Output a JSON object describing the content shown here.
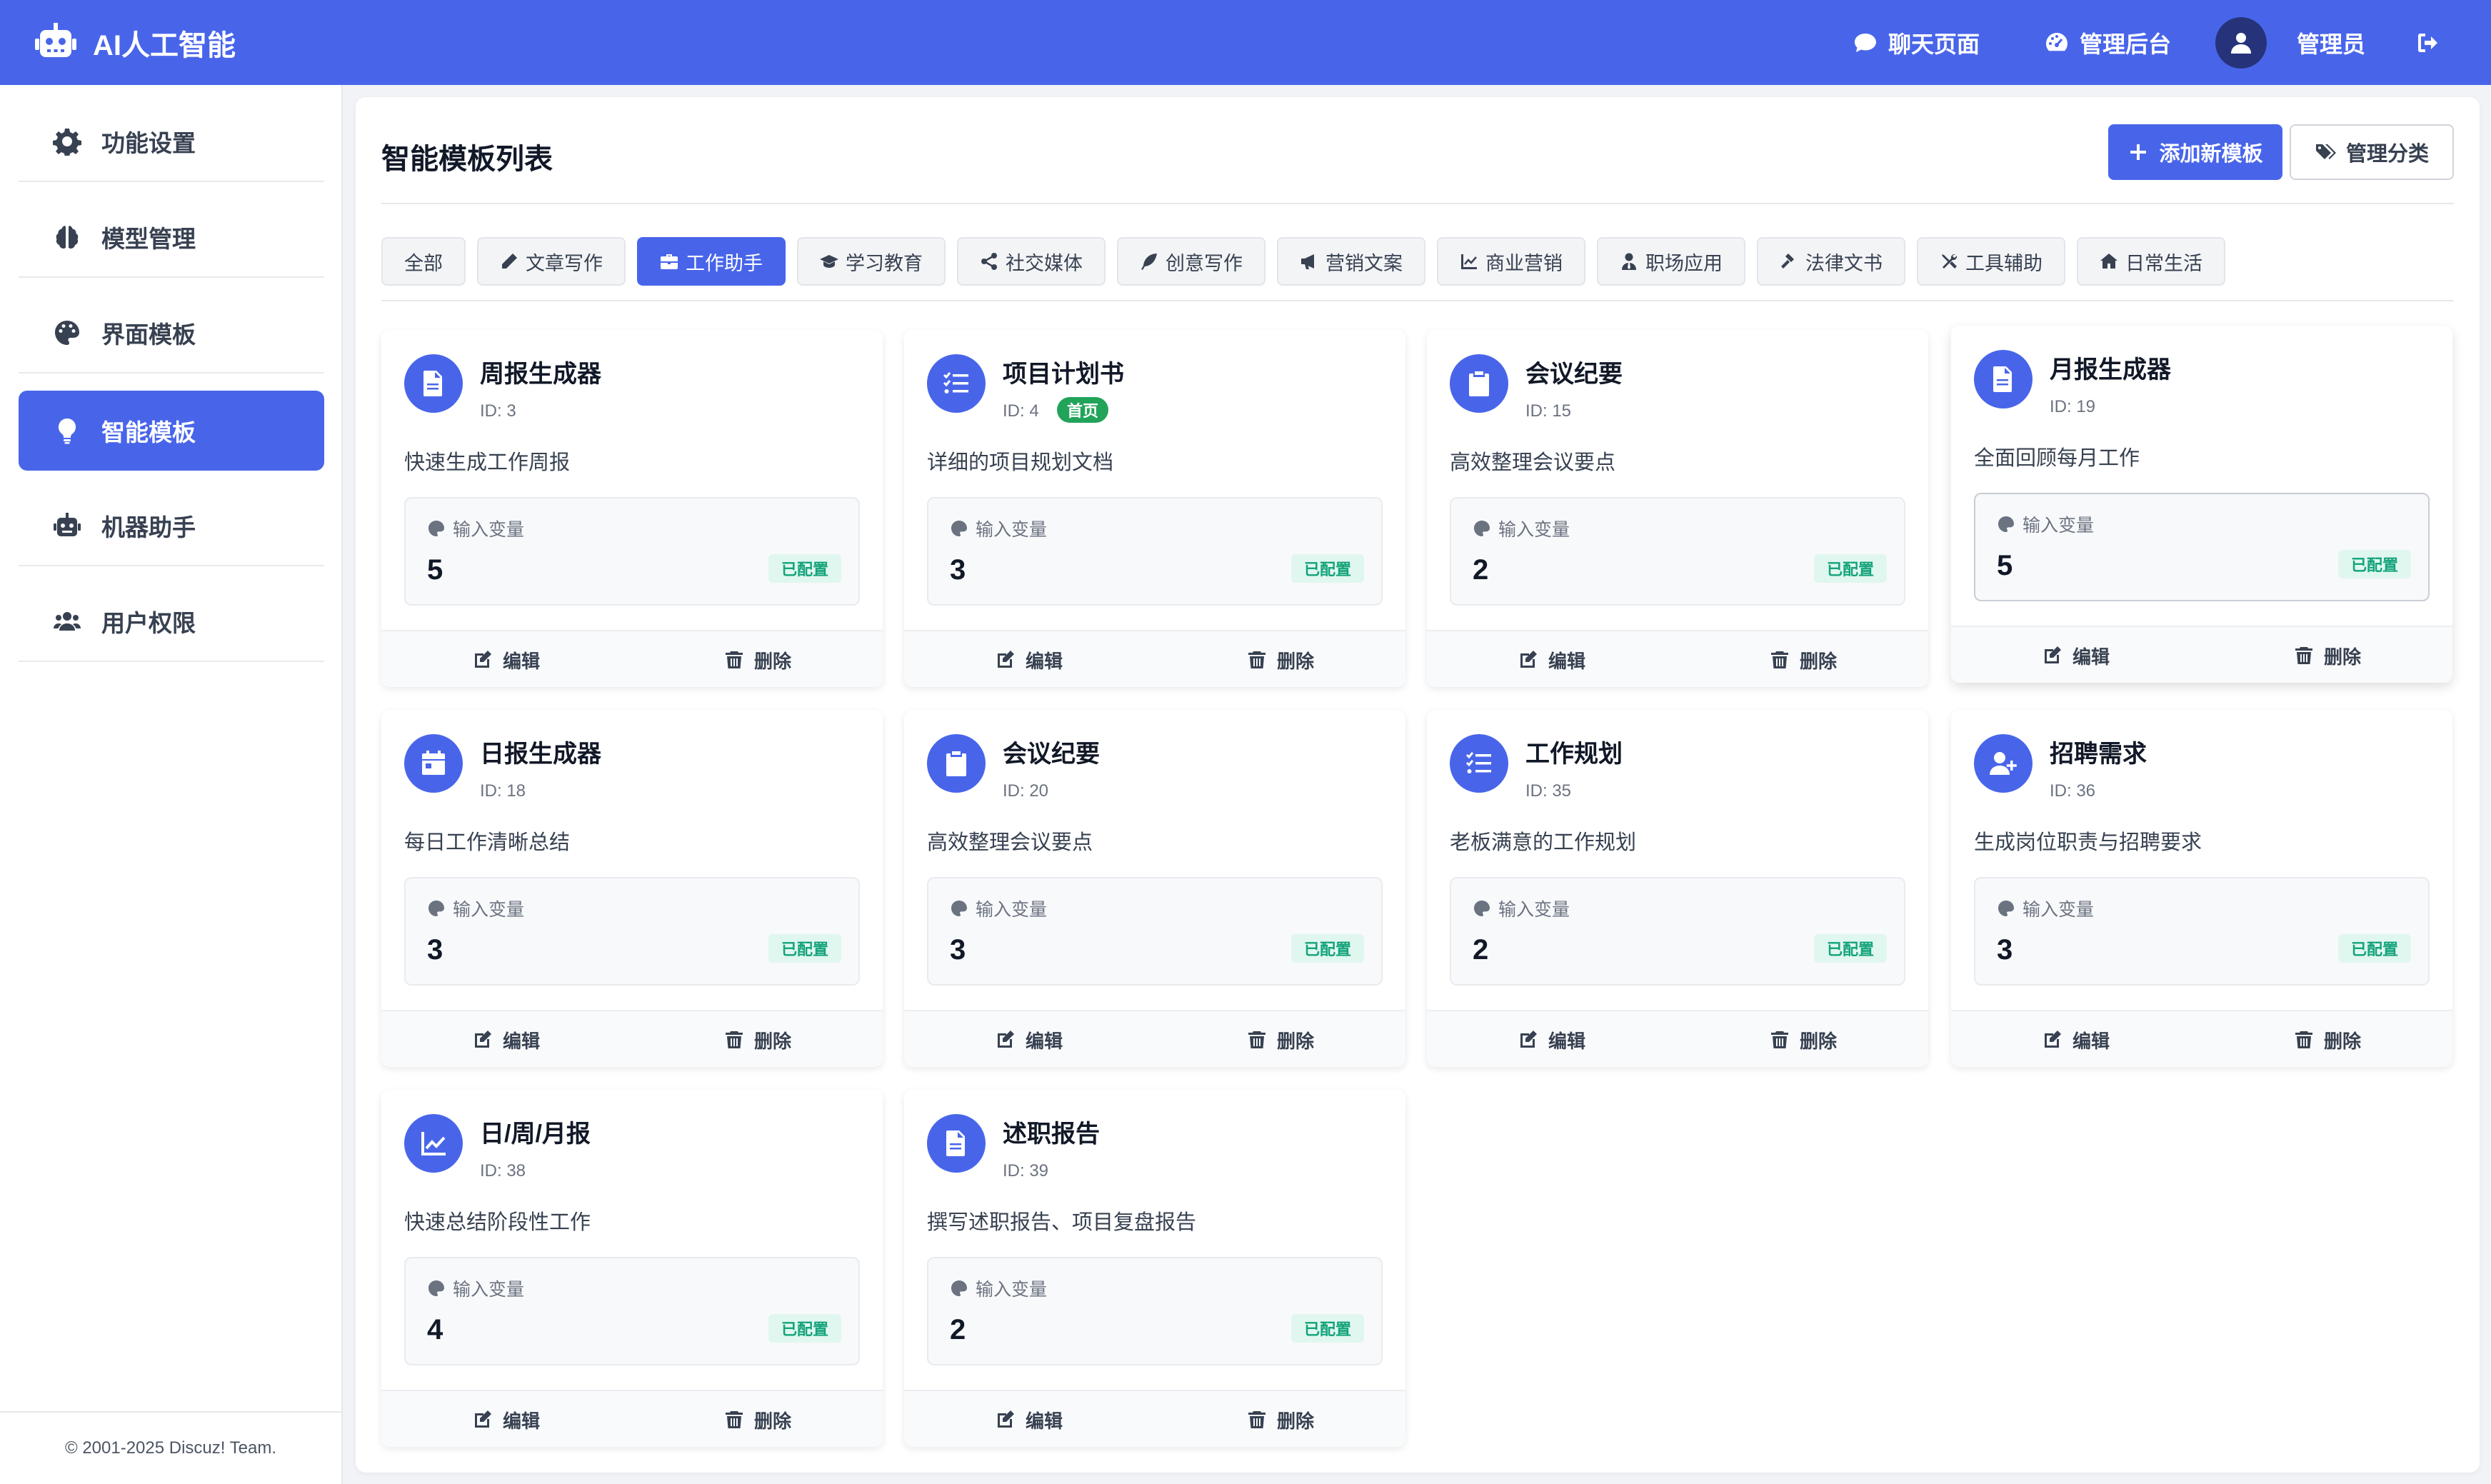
{
  "header": {
    "brand_title": "AI人工智能",
    "chat_label": "聊天页面",
    "admin_label": "管理后台",
    "user_name": "管理员",
    "accent_color": "#4865ea"
  },
  "sidebar": {
    "items": [
      {
        "label": "功能设置",
        "icon": "gear-icon"
      },
      {
        "label": "模型管理",
        "icon": "brain-icon"
      },
      {
        "label": "界面模板",
        "icon": "palette-icon"
      },
      {
        "label": "智能模板",
        "icon": "lightbulb-icon",
        "active": true
      },
      {
        "label": "机器助手",
        "icon": "robot-icon"
      },
      {
        "label": "用户权限",
        "icon": "users-icon"
      }
    ],
    "footer": "© 2001-2025 Discuz! Team."
  },
  "main": {
    "title": "智能模板列表",
    "add_button": "添加新模板",
    "manage_categories_button": "管理分类",
    "filters": [
      {
        "label": "全部"
      },
      {
        "label": "文章写作",
        "icon": "pencil-icon"
      },
      {
        "label": "工作助手",
        "icon": "briefcase-icon",
        "active": true
      },
      {
        "label": "学习教育",
        "icon": "graduation-cap-icon"
      },
      {
        "label": "社交媒体",
        "icon": "share-icon"
      },
      {
        "label": "创意写作",
        "icon": "feather-icon"
      },
      {
        "label": "营销文案",
        "icon": "megaphone-icon"
      },
      {
        "label": "商业营销",
        "icon": "chart-line-icon"
      },
      {
        "label": "职场应用",
        "icon": "user-tie-icon"
      },
      {
        "label": "法律文书",
        "icon": "gavel-icon"
      },
      {
        "label": "工具辅助",
        "icon": "tools-icon"
      },
      {
        "label": "日常生活",
        "icon": "home-icon"
      }
    ],
    "cards": [
      {
        "title": "周报生成器",
        "id": "ID: 3",
        "desc": "快速生成工作周报",
        "var_label": "输入变量",
        "var_count": "5",
        "badge": "已配置",
        "icon": "file-icon",
        "edit": "编辑",
        "delete": "删除"
      },
      {
        "title": "项目计划书",
        "id": "ID: 4",
        "tag": "首页",
        "desc": "详细的项目规划文档",
        "var_label": "输入变量",
        "var_count": "3",
        "badge": "已配置",
        "icon": "tasks-icon",
        "edit": "编辑",
        "delete": "删除"
      },
      {
        "title": "会议纪要",
        "id": "ID: 15",
        "desc": "高效整理会议要点",
        "var_label": "输入变量",
        "var_count": "2",
        "badge": "已配置",
        "icon": "clipboard-icon",
        "edit": "编辑",
        "delete": "删除"
      },
      {
        "title": "月报生成器",
        "id": "ID: 19",
        "desc": "全面回顾每月工作",
        "var_label": "输入变量",
        "var_count": "5",
        "badge": "已配置",
        "icon": "file-icon",
        "edit": "编辑",
        "delete": "删除"
      },
      {
        "title": "日报生成器",
        "id": "ID: 18",
        "desc": "每日工作清晰总结",
        "var_label": "输入变量",
        "var_count": "3",
        "badge": "已配置",
        "icon": "calendar-icon",
        "edit": "编辑",
        "delete": "删除"
      },
      {
        "title": "会议纪要",
        "id": "ID: 20",
        "desc": "高效整理会议要点",
        "var_label": "输入变量",
        "var_count": "3",
        "badge": "已配置",
        "icon": "clipboard-icon",
        "edit": "编辑",
        "delete": "删除"
      },
      {
        "title": "工作规划",
        "id": "ID: 35",
        "desc": "老板满意的工作规划",
        "var_label": "输入变量",
        "var_count": "2",
        "badge": "已配置",
        "icon": "tasks-icon",
        "edit": "编辑",
        "delete": "删除"
      },
      {
        "title": "招聘需求",
        "id": "ID: 36",
        "desc": "生成岗位职责与招聘要求",
        "var_label": "输入变量",
        "var_count": "3",
        "badge": "已配置",
        "icon": "user-plus-icon",
        "edit": "编辑",
        "delete": "删除"
      },
      {
        "title": "日/周/月报",
        "id": "ID: 38",
        "desc": "快速总结阶段性工作",
        "var_label": "输入变量",
        "var_count": "4",
        "badge": "已配置",
        "icon": "chart-line-icon",
        "edit": "编辑",
        "delete": "删除"
      },
      {
        "title": "述职报告",
        "id": "ID: 39",
        "desc": "撰写述职报告、项目复盘报告",
        "var_label": "输入变量",
        "var_count": "2",
        "badge": "已配置",
        "icon": "file-icon",
        "edit": "编辑",
        "delete": "删除"
      }
    ]
  }
}
